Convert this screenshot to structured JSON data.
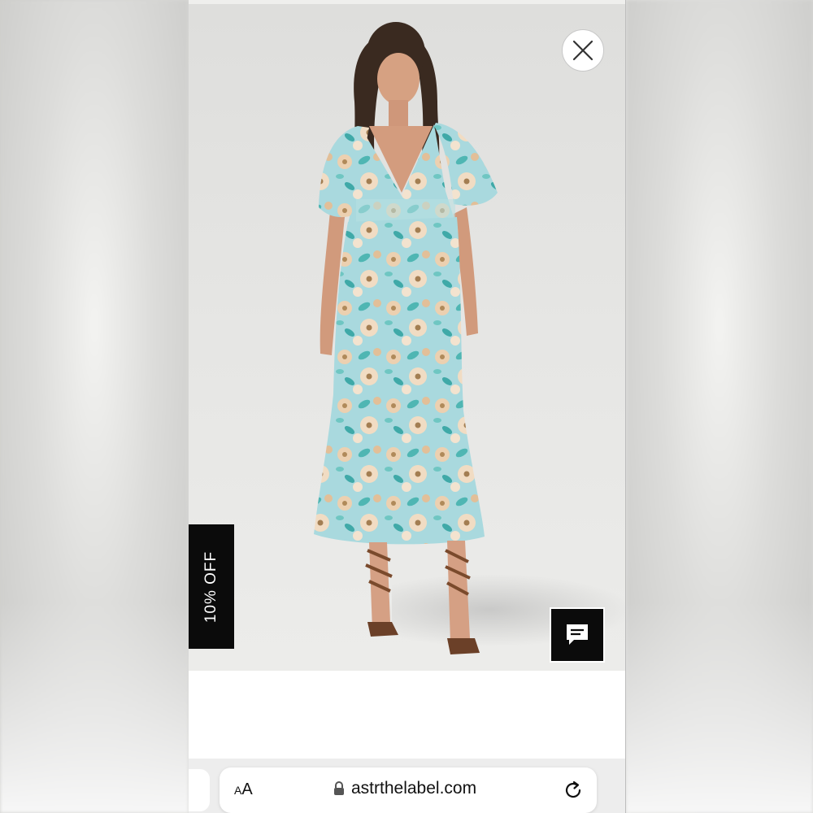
{
  "promo": {
    "discount_label": "10% OFF"
  },
  "browser": {
    "text_size_label_small": "A",
    "text_size_label_large": "A",
    "url": "astrthelabel.com"
  },
  "icons": {
    "close": "close-icon",
    "chat": "chat-icon",
    "lock": "lock-icon",
    "reload": "reload-icon"
  },
  "colors": {
    "backdrop": "#dededc",
    "dress_base": "#a9d9de",
    "dress_accent": "#e8c9a8",
    "tab_black": "#0b0b0b"
  }
}
